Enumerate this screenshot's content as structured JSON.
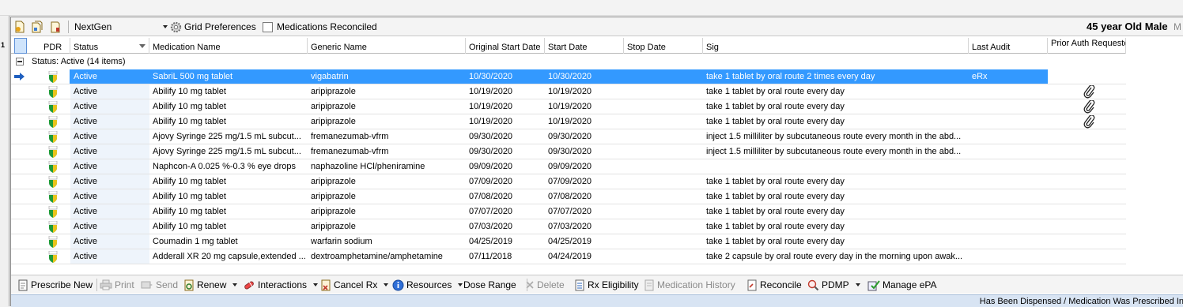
{
  "toolbar": {
    "provider": "NextGen",
    "grid_preferences": "Grid Preferences",
    "meds_reconciled": "Medications Reconciled",
    "patient_summary": "45 year Old Male",
    "patient_sep": "M",
    "icons": [
      "document-icon",
      "document-stack-icon",
      "clipboard-icon"
    ]
  },
  "left_marker": "1",
  "grid": {
    "columns": [
      "PDR",
      "Status",
      "Medication Name",
      "Generic Name",
      "Original Start Date",
      "Start Date",
      "Stop Date",
      "Sig",
      "Last Audit",
      "Prior Auth Requested"
    ],
    "group_label": "Status:  Active (14 items)",
    "rows": [
      {
        "status": "Active",
        "name": "SabriL 500 mg tablet",
        "generic": "vigabatrin",
        "orig": "10/30/2020",
        "start": "10/30/2020",
        "stop": "",
        "sig": "take 1 tablet by oral route 2 times every day",
        "audit": "eRx",
        "paperclip": false,
        "selected": true
      },
      {
        "status": "Active",
        "name": "Abilify 10 mg tablet",
        "generic": "aripiprazole",
        "orig": "10/19/2020",
        "start": "10/19/2020",
        "stop": "",
        "sig": "take 1 tablet by oral route  every day",
        "audit": "",
        "paperclip": true,
        "selected": false
      },
      {
        "status": "Active",
        "name": "Abilify 10 mg tablet",
        "generic": "aripiprazole",
        "orig": "10/19/2020",
        "start": "10/19/2020",
        "stop": "",
        "sig": "take 1 tablet by oral route  every day",
        "audit": "",
        "paperclip": true,
        "selected": false
      },
      {
        "status": "Active",
        "name": "Abilify 10 mg tablet",
        "generic": "aripiprazole",
        "orig": "10/19/2020",
        "start": "10/19/2020",
        "stop": "",
        "sig": "take 1 tablet by oral route  every day",
        "audit": "",
        "paperclip": true,
        "selected": false
      },
      {
        "status": "Active",
        "name": "Ajovy Syringe 225 mg/1.5 mL subcut...",
        "generic": "fremanezumab-vfrm",
        "orig": "09/30/2020",
        "start": "09/30/2020",
        "stop": "",
        "sig": "inject 1.5 milliliter by subcutaneous route  every month in the abd...",
        "audit": "",
        "paperclip": false,
        "selected": false
      },
      {
        "status": "Active",
        "name": "Ajovy Syringe 225 mg/1.5 mL subcut...",
        "generic": "fremanezumab-vfrm",
        "orig": "09/30/2020",
        "start": "09/30/2020",
        "stop": "",
        "sig": "inject 1.5 milliliter by subcutaneous route  every month in the abd...",
        "audit": "",
        "paperclip": false,
        "selected": false
      },
      {
        "status": "Active",
        "name": "Naphcon-A 0.025 %-0.3 % eye drops",
        "generic": "naphazoline HCl/pheniramine",
        "orig": "09/09/2020",
        "start": "09/09/2020",
        "stop": "",
        "sig": "",
        "audit": "",
        "paperclip": false,
        "selected": false
      },
      {
        "status": "Active",
        "name": "Abilify 10 mg tablet",
        "generic": "aripiprazole",
        "orig": "07/09/2020",
        "start": "07/09/2020",
        "stop": "",
        "sig": "take 1 tablet by oral route  every day",
        "audit": "",
        "paperclip": false,
        "selected": false
      },
      {
        "status": "Active",
        "name": "Abilify 10 mg tablet",
        "generic": "aripiprazole",
        "orig": "07/08/2020",
        "start": "07/08/2020",
        "stop": "",
        "sig": "take 1 tablet by oral route  every day",
        "audit": "",
        "paperclip": false,
        "selected": false
      },
      {
        "status": "Active",
        "name": "Abilify 10 mg tablet",
        "generic": "aripiprazole",
        "orig": "07/07/2020",
        "start": "07/07/2020",
        "stop": "",
        "sig": "take 1 tablet by oral route  every day",
        "audit": "",
        "paperclip": false,
        "selected": false
      },
      {
        "status": "Active",
        "name": "Abilify 10 mg tablet",
        "generic": "aripiprazole",
        "orig": "07/03/2020",
        "start": "07/03/2020",
        "stop": "",
        "sig": "take 1 tablet by oral route  every day",
        "audit": "",
        "paperclip": false,
        "selected": false
      },
      {
        "status": "Active",
        "name": "Coumadin 1 mg tablet",
        "generic": "warfarin sodium",
        "orig": "04/25/2019",
        "start": "04/25/2019",
        "stop": "",
        "sig": "take 1 tablet by oral route  every day",
        "audit": "",
        "paperclip": false,
        "selected": false
      },
      {
        "status": "Active",
        "name": "Adderall XR 20 mg capsule,extended ...",
        "generic": "dextroamphetamine/amphetamine",
        "orig": "07/11/2018",
        "start": "04/24/2019",
        "stop": "",
        "sig": "take 2 capsule by oral route  every day in the morning upon awak...",
        "audit": "",
        "paperclip": false,
        "selected": false
      }
    ]
  },
  "bottom_toolbar": [
    {
      "label": "Prescribe New",
      "icon": "prescription-pad-icon",
      "enabled": true,
      "dropdown": false
    },
    {
      "label": "Print",
      "icon": "printer-icon",
      "enabled": false,
      "dropdown": false
    },
    {
      "label": "Send",
      "icon": "send-icon",
      "enabled": false,
      "dropdown": false
    },
    {
      "label": "Renew",
      "icon": "renew-icon",
      "enabled": true,
      "dropdown": true
    },
    {
      "label": "Interactions",
      "icon": "interactions-icon",
      "enabled": true,
      "dropdown": true
    },
    {
      "label": "Cancel Rx",
      "icon": "cancel-rx-icon",
      "enabled": true,
      "dropdown": true
    },
    {
      "label": "Resources",
      "icon": "info-icon",
      "enabled": true,
      "dropdown": true
    },
    {
      "label": "Dose Range",
      "icon": "",
      "enabled": true,
      "dropdown": false
    },
    {
      "label": "Delete",
      "icon": "delete-x-icon",
      "enabled": false,
      "dropdown": false
    },
    {
      "label": "Rx Eligibility",
      "icon": "eligibility-icon",
      "enabled": true,
      "dropdown": false
    },
    {
      "label": "Medication History",
      "icon": "history-icon",
      "enabled": false,
      "dropdown": false
    },
    {
      "label": "Reconcile",
      "icon": "reconcile-icon",
      "enabled": true,
      "dropdown": false
    },
    {
      "label": "PDMP",
      "icon": "pdmp-search-icon",
      "enabled": true,
      "dropdown": true
    },
    {
      "label": "Manage ePA",
      "icon": "epa-check-icon",
      "enabled": true,
      "dropdown": false
    }
  ],
  "status_bar": "Has Been Dispensed / Medication Was Prescribed In",
  "colors": {
    "selection": "#3399ff",
    "status_bg": "#d8e4f3",
    "header_selected": "#cfe4fb"
  }
}
